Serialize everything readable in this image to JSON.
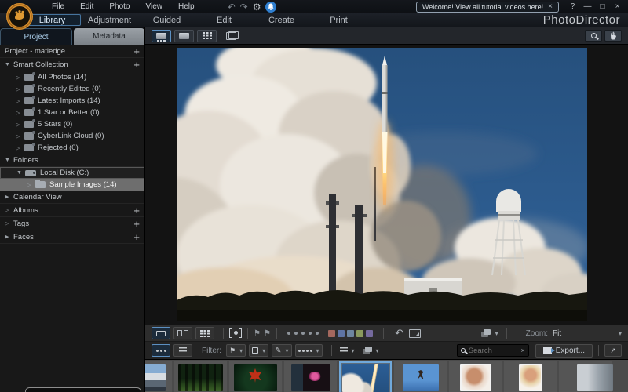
{
  "titlebar": {
    "menus": [
      "File",
      "Edit",
      "Photo",
      "View",
      "Help"
    ],
    "notification": "Welcome! View all tutorial videos here!",
    "help": "?",
    "minimize": "—",
    "maximize": "□",
    "close": "×"
  },
  "brand": "PhotoDirector",
  "mode_tabs": [
    "Library",
    "Adjustment",
    "Guided",
    "Edit",
    "Create",
    "Print"
  ],
  "panel_tabs": [
    "Project",
    "Metadata"
  ],
  "tree": {
    "project_header": "Project - matledge",
    "smart_collection_label": "Smart Collection",
    "smart_items": [
      "All Photos (14)",
      "Recently Edited (0)",
      "Latest Imports (14)",
      "1 Star or Better (0)",
      "5 Stars (0)",
      "CyberLink Cloud (0)",
      "Rejected (0)"
    ],
    "folders_label": "Folders",
    "drive": "Local Disk (C:)",
    "folder_selected": "Sample Images (14)",
    "calendar": "Calendar View",
    "albums": "Albums",
    "tags": "Tags",
    "faces": "Faces"
  },
  "viewer_bar": {
    "zoom_label": "Zoom:",
    "zoom_value": "Fit"
  },
  "browser_bar": {
    "filter_label": "Filter:",
    "search_placeholder": "Search",
    "export_label": "Export..."
  },
  "label_colors": [
    "#a4685e",
    "#5e74a4",
    "#6e86a0",
    "#8a9a5e",
    "#756a9e"
  ],
  "accent_color": "#70a9dc",
  "glyphs": {
    "plus": "+",
    "tri_down": "▼",
    "tri_right": "▶",
    "tri_right_open": "▷",
    "undo": "↶",
    "redo": "↷",
    "gear": "⚙",
    "close": "×",
    "dropdown": "▾",
    "flag": "⚑",
    "pencil": "✎",
    "external": "↗"
  }
}
